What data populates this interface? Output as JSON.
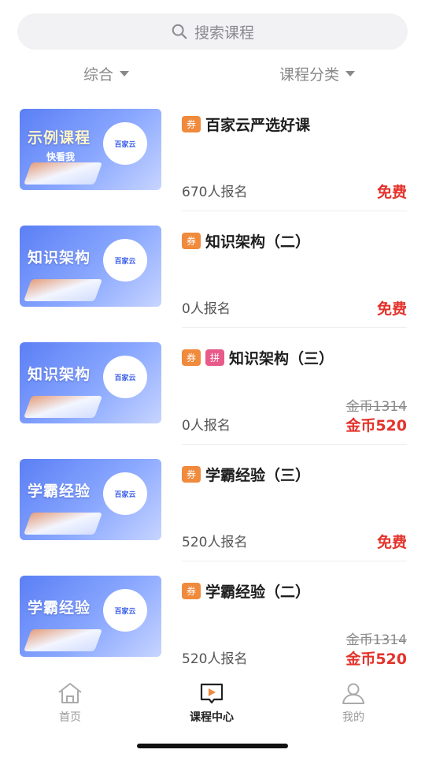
{
  "search": {
    "placeholder": "搜索课程"
  },
  "filters": [
    {
      "label": "综合"
    },
    {
      "label": "课程分类"
    }
  ],
  "courses": [
    {
      "thumb": {
        "title": "示例课程",
        "sub": "快看我",
        "logo": "百家云"
      },
      "tags": [
        "券"
      ],
      "title": "百家云严选好课",
      "enroll": "670人报名",
      "orig_price": "",
      "price": "免费"
    },
    {
      "thumb": {
        "title": "知识架构",
        "sub": "",
        "logo": "百家云"
      },
      "tags": [
        "券"
      ],
      "title": "知识架构（二）",
      "enroll": "0人报名",
      "orig_price": "",
      "price": "免费"
    },
    {
      "thumb": {
        "title": "知识架构",
        "sub": "",
        "logo": "百家云"
      },
      "tags": [
        "券",
        "拼"
      ],
      "title": "知识架构（三）",
      "enroll": "0人报名",
      "orig_price": "金币1314",
      "price": "金币520"
    },
    {
      "thumb": {
        "title": "学霸经验",
        "sub": "",
        "logo": "百家云"
      },
      "tags": [
        "券"
      ],
      "title": "学霸经验（三）",
      "enroll": "520人报名",
      "orig_price": "",
      "price": "免费"
    },
    {
      "thumb": {
        "title": "学霸经验",
        "sub": "",
        "logo": "百家云"
      },
      "tags": [
        "券"
      ],
      "title": "学霸经验（二）",
      "enroll": "520人报名",
      "orig_price": "金币1314",
      "price": "金币520"
    }
  ],
  "tabbar": [
    {
      "label": "首页",
      "icon": "home-icon",
      "active": false
    },
    {
      "label": "课程中心",
      "icon": "course-center-icon",
      "active": true
    },
    {
      "label": "我的",
      "icon": "profile-icon",
      "active": false
    }
  ],
  "colors": {
    "price_red": "#e4322b",
    "tag_orange": "#f08a3c",
    "tag_pink": "#e85a8a",
    "thumb_blue": "#5b7ff5"
  }
}
